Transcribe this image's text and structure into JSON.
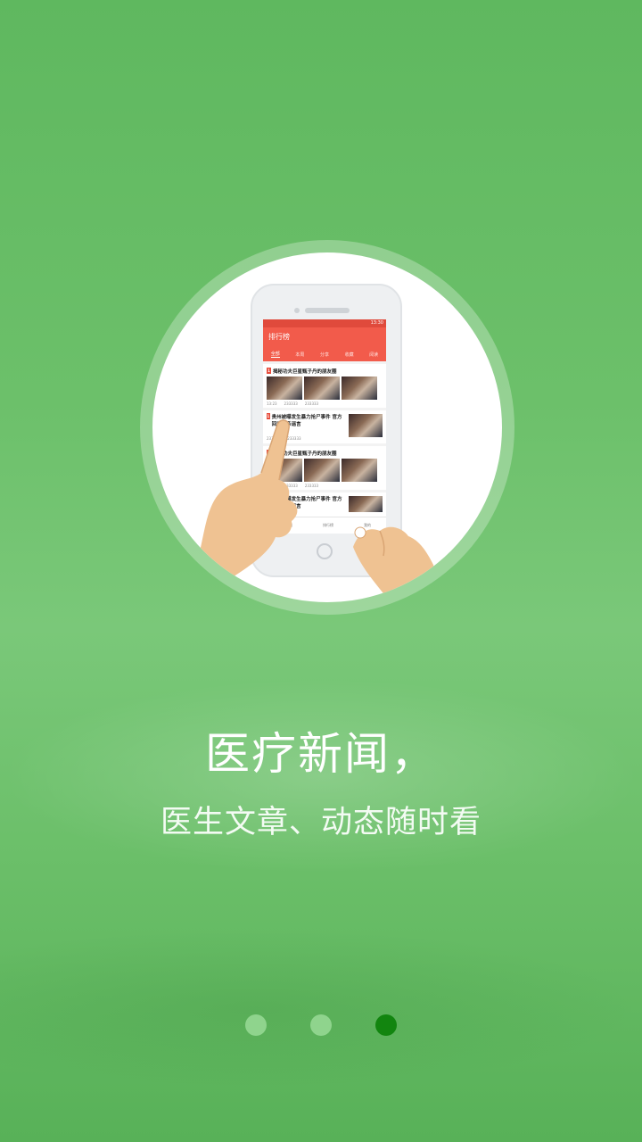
{
  "splash": {
    "headline": "医疗新闻，",
    "subline": "医生文章、动态随时看"
  },
  "phone_screen": {
    "app_title": "排行榜",
    "status_time": "13:30",
    "tabs": [
      "全部",
      "本周",
      "分享",
      "收藏",
      "阅读"
    ],
    "cards": [
      {
        "rank": "1",
        "title": "揭秘功夫巨星甄子丹的朋友圈",
        "time": "13:23",
        "views": "233333",
        "shares": "233333"
      },
      {
        "rank": "1",
        "title": "贵州被曝发生暴力抢尸事件 官方回应称系谣言",
        "views": "233333",
        "shares": "233333"
      },
      {
        "rank": "1",
        "title": "揭秘功夫巨星甄子丹的朋友圈",
        "time": "13:23",
        "views": "233333",
        "shares": "233333"
      },
      {
        "rank": "1",
        "title": "贵州被曝发生暴力抢尸事件 官方回应称系谣言"
      }
    ],
    "bottom_nav": [
      "每日荐阅",
      "排行榜",
      "我的"
    ]
  },
  "pager": {
    "count": 3,
    "active_index": 2,
    "active_color": "#12850f",
    "inactive_color": "#8fd48d"
  },
  "colors": {
    "background": "#6cc06a",
    "app_red": "#f25b4b"
  }
}
